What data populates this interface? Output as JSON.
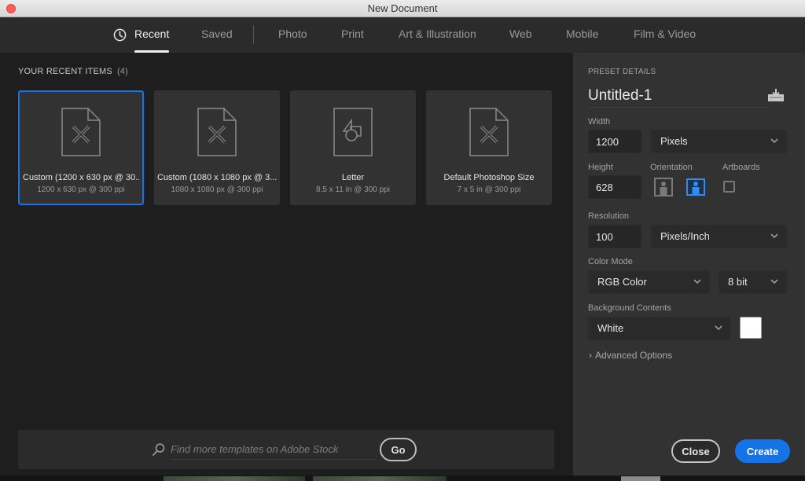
{
  "window": {
    "title": "New Document"
  },
  "tabs": [
    {
      "label": "Recent",
      "active": true,
      "icon": "clock-icon"
    },
    {
      "label": "Saved",
      "active": false
    },
    {
      "label": "Photo",
      "active": false
    },
    {
      "label": "Print",
      "active": false
    },
    {
      "label": "Art & Illustration",
      "active": false
    },
    {
      "label": "Web",
      "active": false
    },
    {
      "label": "Mobile",
      "active": false
    },
    {
      "label": "Film & Video",
      "active": false
    }
  ],
  "recent": {
    "heading": "YOUR RECENT ITEMS",
    "count": "(4)",
    "items": [
      {
        "title": "Custom (1200 x 630 px @ 30...",
        "subtitle": "1200 x 630 px @ 300 ppi",
        "icon": "custom-document-icon",
        "selected": true
      },
      {
        "title": "Custom (1080 x 1080 px @ 3...",
        "subtitle": "1080 x 1080 px @ 300 ppi",
        "icon": "custom-document-icon",
        "selected": false
      },
      {
        "title": "Letter",
        "subtitle": "8.5 x 11 in @ 300 ppi",
        "icon": "print-document-icon",
        "selected": false
      },
      {
        "title": "Default Photoshop Size",
        "subtitle": "7 x 5 in @ 300 ppi",
        "icon": "custom-document-icon",
        "selected": false
      }
    ]
  },
  "stock": {
    "placeholder": "Find more templates on Adobe Stock",
    "value": "",
    "go_label": "Go"
  },
  "preset": {
    "heading": "PRESET DETAILS",
    "name": "Untitled-1",
    "width_label": "Width",
    "width_value": "1200",
    "width_unit": "Pixels",
    "height_label": "Height",
    "height_value": "628",
    "orientation_label": "Orientation",
    "orientation_selected": "landscape",
    "artboards_label": "Artboards",
    "artboards_checked": false,
    "resolution_label": "Resolution",
    "resolution_value": "100",
    "resolution_unit": "Pixels/Inch",
    "color_mode_label": "Color Mode",
    "color_mode": "RGB Color",
    "bit_depth": "8 bit",
    "background_label": "Background Contents",
    "background": "White",
    "background_color": "#ffffff",
    "advanced_label": "Advanced Options"
  },
  "actions": {
    "close_label": "Close",
    "create_label": "Create"
  },
  "colors": {
    "accent": "#1473e6",
    "close_dot": "#fc5f57"
  }
}
